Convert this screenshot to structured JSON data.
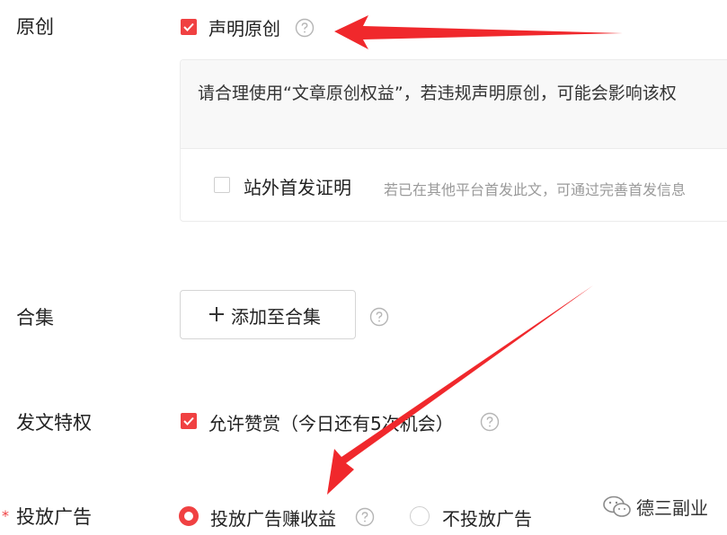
{
  "original": {
    "label": "原创",
    "declare_label": "声明原创",
    "declare_checked": true,
    "notice": "请合理使用“文章原创权益”，若违规声明原创，可能会影响该权",
    "first_publish_label": "站外首发证明",
    "first_publish_checked": false,
    "first_publish_hint": "若已在其他平台首发此文，可通过完善首发信息"
  },
  "collection": {
    "label": "合集",
    "add_button_label": "添加至合集"
  },
  "privileges": {
    "label": "发文特权",
    "reward_label": "允许赞赏（今日还有5次机会）",
    "reward_checked": true
  },
  "ads": {
    "required_mark": "*",
    "label": "投放广告",
    "options": [
      {
        "label": "投放广告赚收益",
        "selected": true
      },
      {
        "label": "不投放广告",
        "selected": false
      }
    ]
  },
  "watermark": {
    "text": "德三副业"
  },
  "colors": {
    "accent": "#f04142",
    "arrow": "#f0282c",
    "muted": "#9a9a9a"
  },
  "icons": [
    "checkbox-checked-icon",
    "question-circle-icon",
    "plus-icon",
    "wechat-icon",
    "arrow-annotation"
  ]
}
